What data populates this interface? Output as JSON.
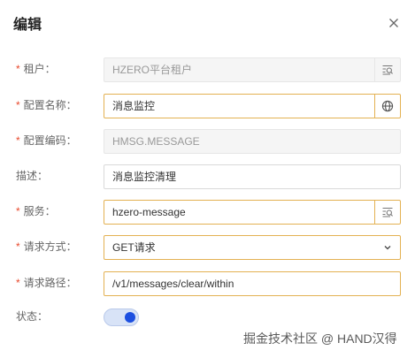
{
  "dialog": {
    "title": "编辑",
    "close_icon": "close-icon"
  },
  "form": {
    "tenant": {
      "label": "租户：",
      "required": true,
      "value": "HZERO平台租户",
      "icon": "lov-search-icon",
      "disabled": true
    },
    "config_name": {
      "label": "配置名称：",
      "required": true,
      "value": "消息监控",
      "icon": "globe-icon"
    },
    "config_code": {
      "label": "配置编码：",
      "required": true,
      "value": "HMSG.MESSAGE",
      "disabled": true
    },
    "description": {
      "label": "描述：",
      "required": false,
      "value": "消息监控清理"
    },
    "service": {
      "label": "服务：",
      "required": true,
      "value": "hzero-message",
      "icon": "lov-search-icon"
    },
    "request_method": {
      "label": "请求方式：",
      "required": true,
      "value": "GET请求",
      "icon": "chevron-down-icon"
    },
    "request_path": {
      "label": "请求路径：",
      "required": true,
      "value": "/v1/messages/clear/within"
    },
    "status": {
      "label": "状态：",
      "required": false,
      "enabled": true
    }
  },
  "watermark": "掘金技术社区 @ HAND汉得",
  "colors": {
    "required_mark": "#e84a2e",
    "required_border": "#e3b152",
    "switch_on": "#1c4fe0"
  }
}
